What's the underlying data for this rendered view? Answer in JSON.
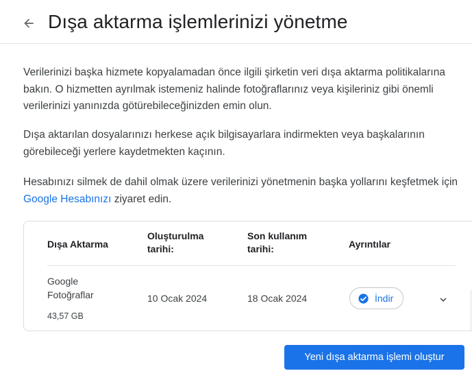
{
  "header": {
    "title": "Dışa aktarma işlemlerinizi yönetme",
    "back_icon": "arrow-left-icon"
  },
  "paragraphs": {
    "p1": "Verilerinizi başka hizmete kopyalamadan önce ilgili şirketin veri dışa aktarma politikalarına bakın. O hizmetten ayrılmak istemeniz halinde fotoğraflarınız veya kişileriniz gibi önemli verilerinizi yanınızda götürebileceğinizden emin olun.",
    "p2": "Dışa aktarılan dosyalarınızı herkese açık bilgisayarlara indirmekten veya başkalarının görebileceği yerlere kaydetmekten kaçının.",
    "p3_before": "Hesabınızı silmek de dahil olmak üzere verilerinizi yönetmenin başka yollarını keşfetmek için ",
    "p3_link": "Google Hesabınızı",
    "p3_after": " ziyaret edin."
  },
  "table": {
    "headers": {
      "export": "Dışa Aktarma",
      "created": "Oluşturulma tarihi:",
      "last_used": "Son kullanım tarihi:",
      "details": "Ayrıntılar"
    },
    "rows": [
      {
        "name": "Google Fotoğraflar",
        "size": "43,57 GB",
        "created": "10 Ocak 2024",
        "last_used": "18 Ocak 2024",
        "download_label": "İndir",
        "download_icon": "check-circle-icon",
        "expand_icon": "chevron-down-icon"
      }
    ]
  },
  "actions": {
    "new_export_label": "Yeni dışa aktarma işlemi oluştur"
  },
  "colors": {
    "accent": "#1a73e8",
    "text": "#3c4043",
    "title": "#202124",
    "border": "#dadce0"
  }
}
